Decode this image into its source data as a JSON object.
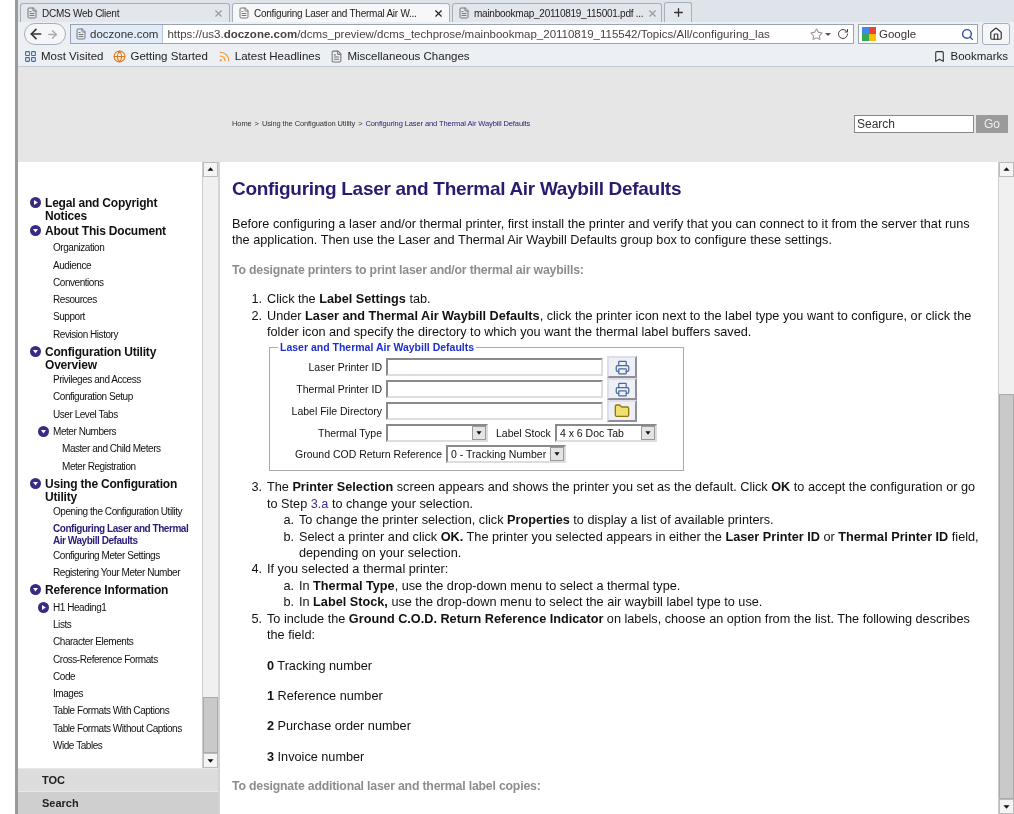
{
  "browser": {
    "tabs": [
      {
        "title": "DCMS Web Client",
        "selected": false
      },
      {
        "title": "Configuring Laser and Thermal Air W...",
        "selected": true
      },
      {
        "title": "mainbookmap_20110819_115001.pdf ...",
        "selected": false
      }
    ],
    "site": "doczone.com",
    "url": "https://us3.**doczone.com**/dcms_preview/dcms_techprose/mainbookmap_20110819_115542/Topics/All/configuring_las",
    "search_engine": "Google",
    "bookmarks": [
      {
        "label": "Most Visited",
        "kind": "smart"
      },
      {
        "label": "Getting Started",
        "kind": "globe"
      },
      {
        "label": "Latest Headlines",
        "kind": "feed"
      },
      {
        "label": "Miscellaneous Changes",
        "kind": "page"
      }
    ],
    "bookmarks_menu": "Bookmarks"
  },
  "header": {
    "breadcrumb": [
      {
        "label": "Home",
        "current": false
      },
      {
        "label": "Using the Configuation Utility",
        "current": false
      },
      {
        "label": "Configuring Laser and Thermal Air Waybill Defaults",
        "current": true
      }
    ],
    "separator": ">",
    "search": {
      "placeholder": "Search",
      "button": "Go"
    }
  },
  "toc": {
    "items": [
      {
        "label": "Legal and Copyright Notices",
        "expanded": false,
        "selected": false
      },
      {
        "label": "About This Document",
        "expanded": true,
        "selected": false,
        "children": [
          {
            "label": "Organization",
            "selected": false
          },
          {
            "label": "Audience",
            "selected": false
          },
          {
            "label": "Conventions",
            "selected": false
          },
          {
            "label": "Resources",
            "selected": false
          },
          {
            "label": "Support",
            "selected": false
          },
          {
            "label": "Revision History",
            "selected": false
          }
        ]
      },
      {
        "label": "Configuration Utility Overview",
        "expanded": true,
        "selected": false,
        "children": [
          {
            "label": "Privileges and Access",
            "selected": false
          },
          {
            "label": "Configuration Setup",
            "selected": false
          },
          {
            "label": "User Level Tabs",
            "selected": false
          },
          {
            "label": "Meter Numbers",
            "expanded": true,
            "selected": false,
            "children": [
              {
                "label": "Master and Child Meters",
                "selected": false
              },
              {
                "label": "Meter Registration",
                "selected": false
              }
            ]
          }
        ]
      },
      {
        "label": "Using the Configuration Utility",
        "expanded": true,
        "selected": false,
        "children": [
          {
            "label": "Opening the Configuration Utility",
            "selected": false
          },
          {
            "label": "Configuring Laser and Thermal Air Waybill Defaults",
            "selected": true
          },
          {
            "label": "Configuring Meter Settings",
            "selected": false
          },
          {
            "label": "Registering Your Meter Number",
            "selected": false
          }
        ]
      },
      {
        "label": "Reference Information",
        "expanded": true,
        "selected": false,
        "children": [
          {
            "label": "H1 Heading1",
            "expanded": false,
            "selected": false
          },
          {
            "label": "Lists",
            "selected": false
          },
          {
            "label": "Character Elements",
            "selected": false
          },
          {
            "label": "Cross-Reference Formats",
            "selected": false
          },
          {
            "label": "Code",
            "selected": false
          },
          {
            "label": "Images",
            "selected": false
          },
          {
            "label": "Table Formats With Captions",
            "selected": false
          },
          {
            "label": "Table Formats Without Captions",
            "selected": false
          },
          {
            "label": "Wide Tables",
            "selected": false
          }
        ]
      }
    ],
    "tabs": [
      {
        "label": "TOC",
        "selected": true
      },
      {
        "label": "Search",
        "selected": false
      }
    ]
  },
  "article": {
    "title": "Configuring Laser and Thermal Air Waybill Defaults",
    "intro": "Before configuring a laser and/or thermal printer, first install the printer and verify that you can connect to it from the server that runs the application. Then use the Laser and Thermal Air Waybill Defaults group box to configure these settings.",
    "procedure_heading": "To designate printers to print laser and/or thermal air waybills:",
    "steps": [
      {
        "number": "1.",
        "text": "Click the **Label Settings** tab."
      },
      {
        "number": "2.",
        "text": "Under **Laser and Thermal Air Waybill Defaults**, click the printer icon next to the label type you want to configure, or click the folder icon and specify the directory to which you want the thermal label buffers saved.",
        "form": {
          "legend": "Laser and Thermal Air Waybill Defaults",
          "rows": [
            {
              "kind": "printer",
              "label": "Laser Printer ID"
            },
            {
              "kind": "printer",
              "label": "Thermal Printer ID"
            },
            {
              "kind": "folder",
              "label": "Label File Directory"
            },
            {
              "kind": "selects",
              "fields": [
                {
                  "label": "Thermal Type"
                },
                {
                  "label": "Label Stock",
                  "value": "4 x 6 Doc Tab"
                }
              ]
            },
            {
              "kind": "select",
              "label": "Ground COD Return Reference",
              "value": "0 - Tracking Number"
            }
          ]
        }
      },
      {
        "number": "3.",
        "text": "The **Printer Selection** screen appears and shows the printer you set as the default. Click **OK** to accept the configuration or go to Step",
        "link": "3.a",
        "text_after": "to change your selection.",
        "substeps": [
          {
            "letter": "a.",
            "text": "To change the printer selection, click **Properties** to display a list of available printers."
          },
          {
            "letter": "b.",
            "text": "Select a printer and click **OK.** The printer you selected appears in either the **Laser Printer ID** or **Thermal Printer ID** field, depending on your selection."
          }
        ]
      },
      {
        "number": "4.",
        "text": "If you selected a thermal printer:",
        "substeps": [
          {
            "letter": "a.",
            "text": "In **Thermal Type**, use the drop-down menu to select a thermal type."
          },
          {
            "letter": "b.",
            "text": "In **Label Stock,** use the drop-down menu to select the air waybill label type to use."
          }
        ]
      },
      {
        "number": "5.",
        "text": "To include the **Ground C.O.D. Return Reference Indicator** on labels, choose an option from the list. The following describes the field:",
        "options": [
          "**0** Tracking number",
          "**1** Reference number",
          "**2** Purchase order number",
          "**3** Invoice number"
        ]
      }
    ],
    "closing_heading": "To designate additional laser and thermal label copies:"
  }
}
